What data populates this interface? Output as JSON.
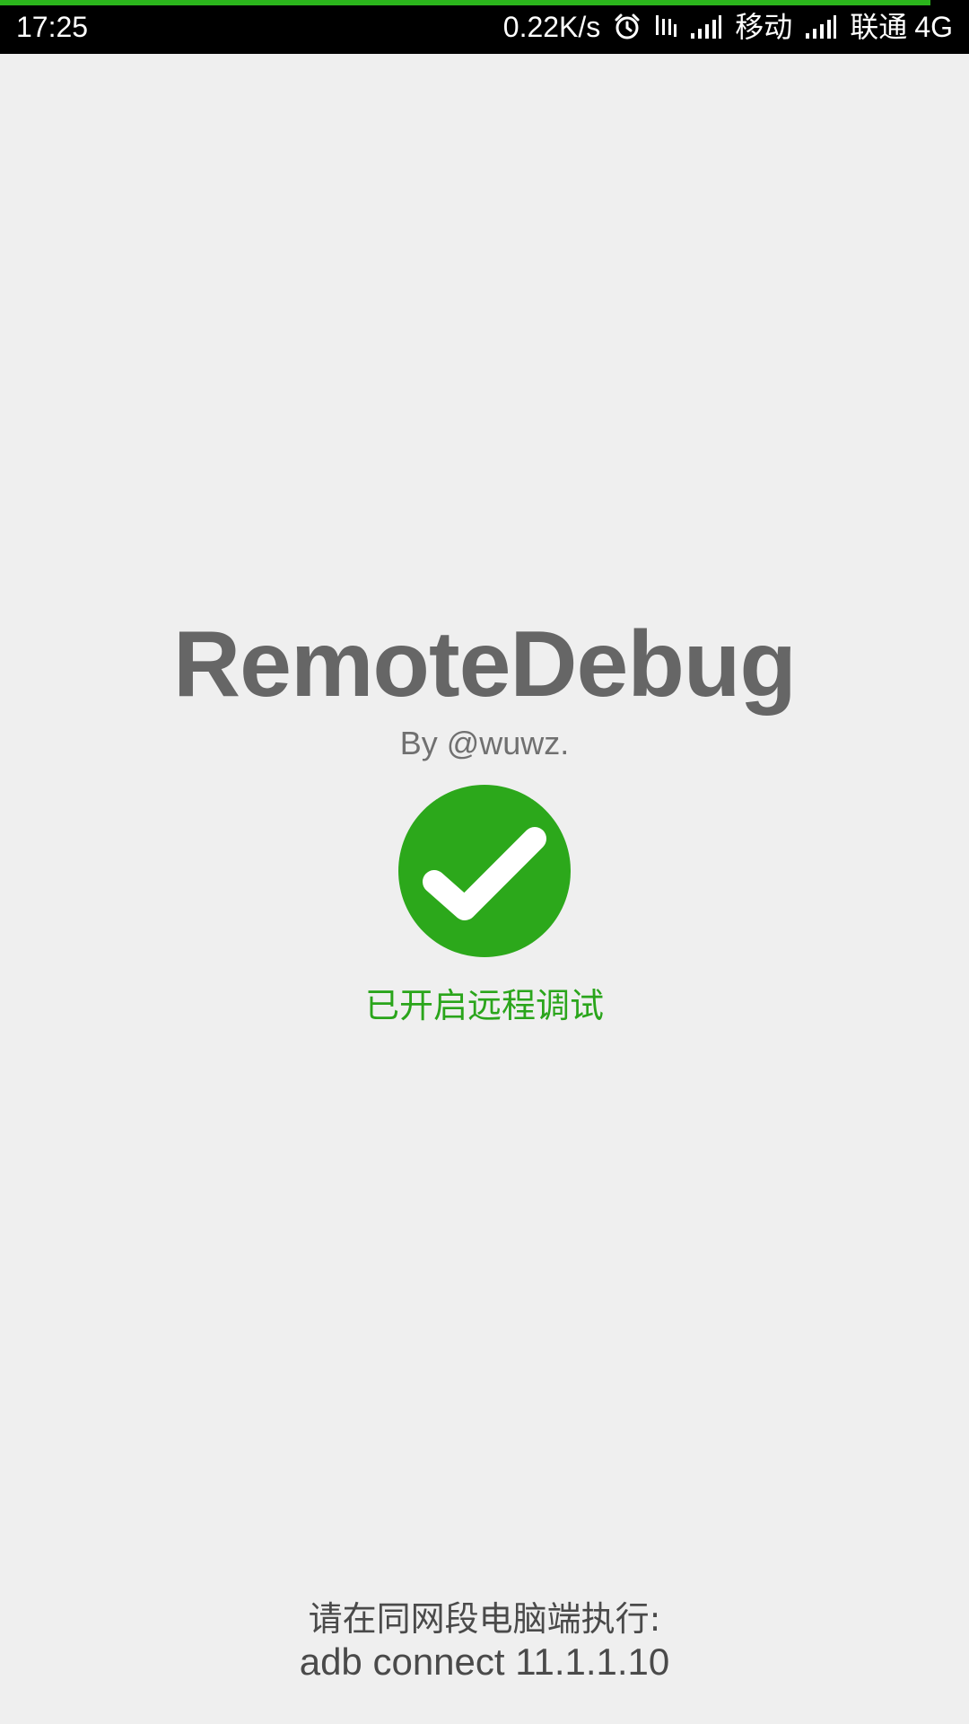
{
  "status_bar": {
    "time": "17:25",
    "net_speed": "0.22K/s",
    "carrier1": "移动",
    "carrier2": "联通",
    "network_type": "4G",
    "icons": [
      "alarm-icon",
      "vibrate-icon",
      "signal-icon",
      "signal-icon"
    ],
    "loading_progress": 0.96,
    "loading_color": "#2bb51c"
  },
  "app": {
    "title": "RemoteDebug",
    "author": "By @wuwz."
  },
  "status": {
    "icon": "check-circle-icon",
    "text": "已开启远程调试",
    "color": "#2aa51b"
  },
  "instructions": {
    "line1": "请在同网段电脑端执行:",
    "command": "adb connect 11.1.1.10"
  }
}
